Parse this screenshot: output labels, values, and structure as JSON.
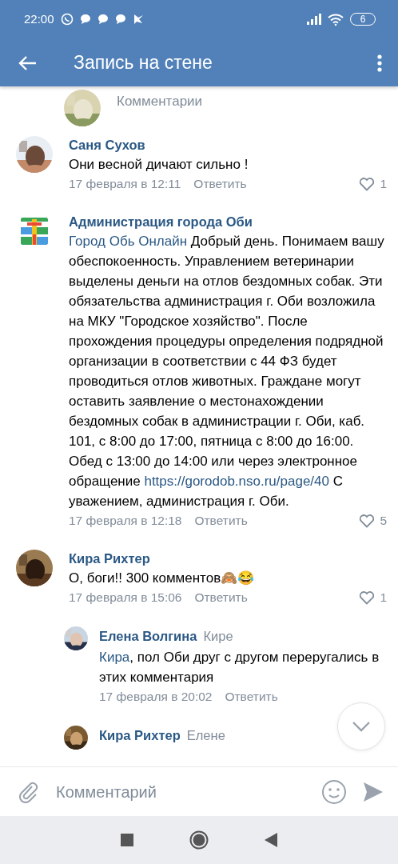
{
  "status_bar": {
    "time": "22:00",
    "battery": "6"
  },
  "header": {
    "title": "Запись на стене"
  },
  "comments": [
    {
      "kind": "partial_top",
      "text_parts": [
        {
          "kind": "text",
          "text": "Комментарии"
        }
      ]
    },
    {
      "kind": "comment",
      "author": "Саня Сухов",
      "text_parts": [
        {
          "kind": "text",
          "text": "Они весной дичают сильно !"
        }
      ],
      "date": "17 февраля в 12:11",
      "reply": "Ответить",
      "likes": "1",
      "liked": false
    },
    {
      "kind": "community_comment",
      "author": "Администрация города Оби",
      "text_parts": [
        {
          "kind": "mention",
          "text": "Город Обь Онлайн"
        },
        {
          "kind": "text",
          "text": " Добрый день. Понимаем вашу обеспокоенность. Управлением ветеринарии выделены деньги на отлов бездомных собак. Эти обязательства администрация г. Оби возложила на МКУ \"Городское хозяйство\". После прохождения процедуры определения подрядной организации в соответствии с 44 ФЗ будет проводиться отлов животных. Граждане могут оставить заявление о местонахождении бездомных собак в администрации г. Оби, каб. 101, с 8:00 до 17:00, пятница с 8:00 до 16:00. Обед с 13:00 до 14:00 или через электронное обращение "
        },
        {
          "kind": "link",
          "text": "https://gorodob.nso.ru/page/40"
        },
        {
          "kind": "text",
          "text": " С уважением, администрация г. Оби."
        }
      ],
      "date": "17 февраля в 12:18",
      "reply": "Ответить",
      "likes": "5",
      "liked": false
    },
    {
      "kind": "comment",
      "author": "Кира Рихтер",
      "text_parts": [
        {
          "kind": "text",
          "text": "О, боги!! 300 комментов🙈😂"
        }
      ],
      "date": "17 февраля в 15:06",
      "reply": "Ответить",
      "likes": "1",
      "liked": false
    },
    {
      "kind": "reply",
      "author": "Елена Волгина",
      "reply_to": "Кире",
      "text_parts": [
        {
          "kind": "mention",
          "text": "Кира"
        },
        {
          "kind": "text",
          "text": ", пол Оби друг с другом переругались в этих комментария"
        }
      ],
      "date": "17 февраля в 20:02",
      "reply": "Ответить"
    },
    {
      "kind": "partial_bottom",
      "author": "Кира Рихтер",
      "reply_to": "Елене"
    }
  ],
  "composer": {
    "placeholder": "Комментарий"
  }
}
